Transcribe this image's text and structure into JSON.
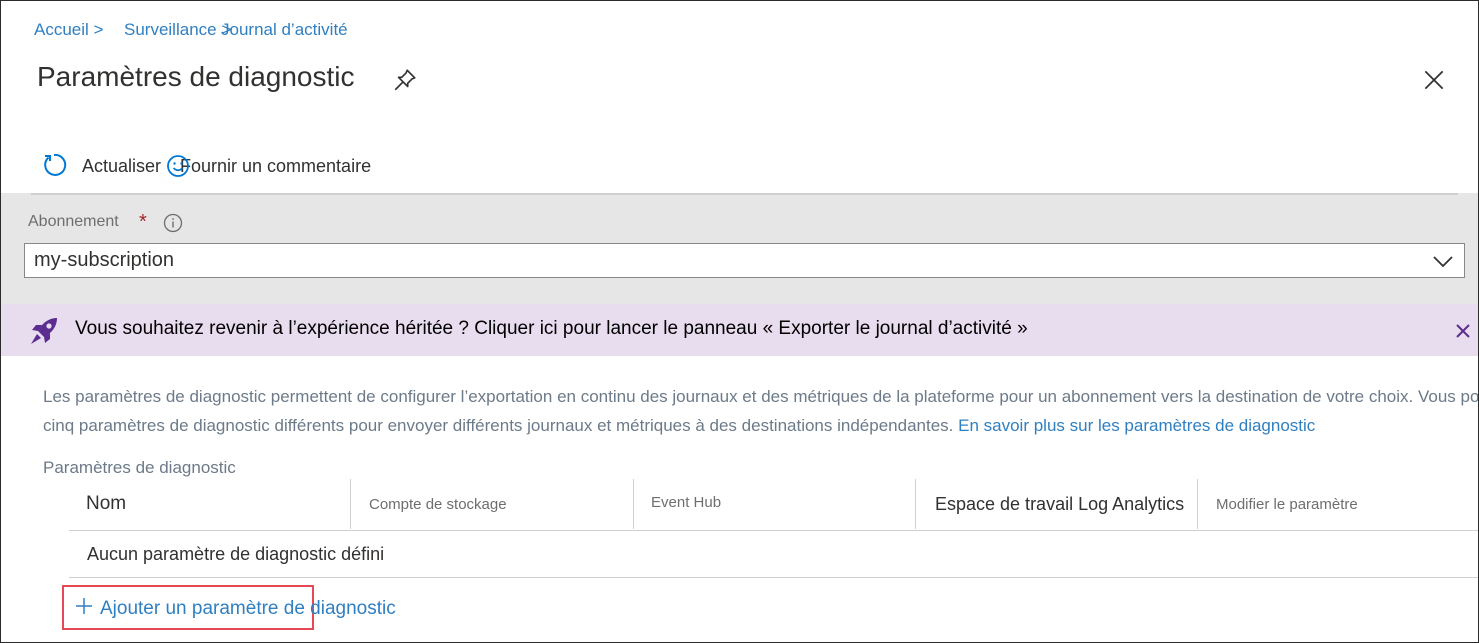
{
  "breadcrumb": {
    "home": "Accueil >",
    "monitor": "Surveillance >",
    "activity_log": "Journal d’activité"
  },
  "page": {
    "title": "Paramètres de diagnostic"
  },
  "toolbar": {
    "refresh_label": "Actualiser",
    "feedback_label": "Fournir un commentaire"
  },
  "subscription": {
    "label": "Abonnement",
    "required_marker": "*",
    "selected_value": "my-subscription"
  },
  "banner": {
    "text": "Vous souhaitez revenir à l’expérience héritée ? Cliquer ici pour lancer le panneau « Exporter le journal d’activité »"
  },
  "description": {
    "line1": "Les paramètres de diagnostic permettent de configurer l’exportation en continu des journaux et des métriques de la plateforme pour un abonnement vers la destination de votre choix. Vous pouvez créer jusqu’à",
    "line2_text": "cinq paramètres de diagnostic différents pour envoyer différents journaux et métriques à des destinations indépendantes.",
    "line2_link": "En savoir plus sur les paramètres de diagnostic"
  },
  "settings": {
    "section_label": "Paramètres de diagnostic",
    "columns": {
      "name": "Nom",
      "storage": "Compte de stockage",
      "event_hub": "Event Hub",
      "log_analytics": "Espace de travail Log Analytics",
      "edit": "Modifier le paramètre"
    },
    "empty_message": "Aucun paramètre de diagnostic défini",
    "add_label": "Ajouter un paramètre de diagnostic"
  },
  "colors": {
    "link": "#2f7fc1",
    "banner_bg": "#e8dcef",
    "banner_icon": "#5c2d91",
    "required": "#a4262c",
    "highlight_border": "#e74856",
    "subscription_panel_bg": "#e6e6e6"
  },
  "icons": {
    "pin": "pin-icon",
    "close": "close-icon",
    "refresh": "refresh-icon",
    "feedback": "smiley-icon",
    "info": "info-icon",
    "chevron": "chevron-down-icon",
    "rocket": "rocket-icon",
    "add": "plus-icon"
  }
}
